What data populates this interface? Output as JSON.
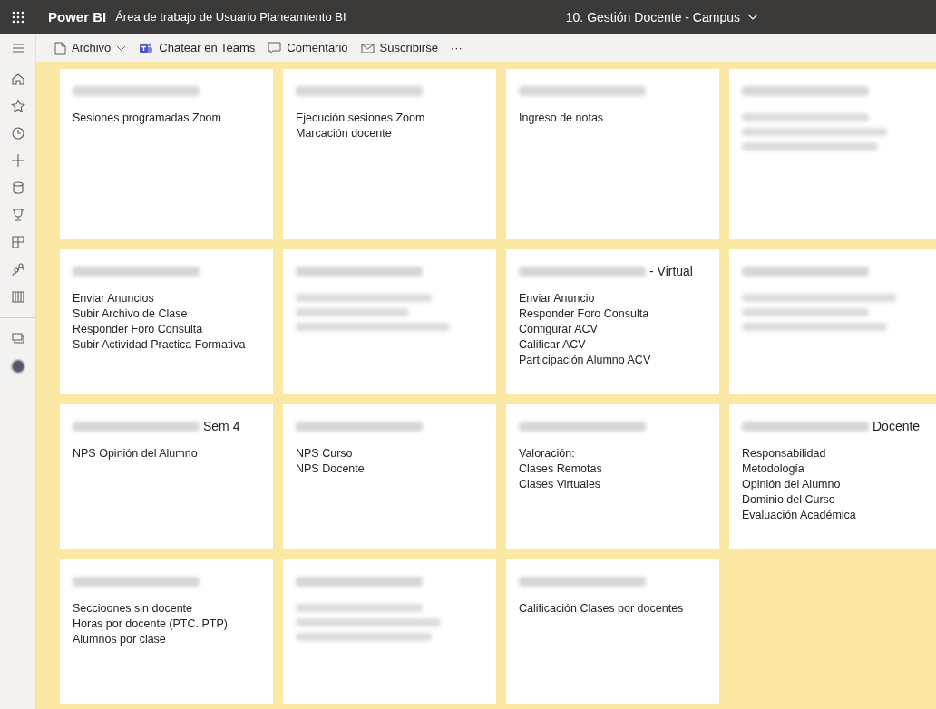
{
  "header": {
    "app_name": "Power BI",
    "workspace": "Área de trabajo de Usuario Planeamiento BI",
    "report": "10. Gestión Docente - Campus"
  },
  "toolbar": [
    {
      "kind": "file",
      "label": "Archivo"
    },
    {
      "kind": "teams",
      "label": "Chatear en Teams"
    },
    {
      "kind": "comment",
      "label": "Comentario"
    },
    {
      "kind": "subscribe",
      "label": "Suscribirse"
    },
    {
      "kind": "more",
      "label": "···"
    }
  ],
  "tiles": [
    {
      "kind": "text",
      "lines": [
        "Sesiones programadas Zoom"
      ]
    },
    {
      "kind": "text",
      "lines": [
        "Ejecución sesiones Zoom",
        "Marcación docente"
      ]
    },
    {
      "kind": "text",
      "lines": [
        "Ingreso de notas"
      ]
    },
    {
      "kind": "blurred"
    },
    {
      "kind": "text",
      "lines": [
        "Enviar Anuncios",
        "Subir Archivo de Clase",
        "Responder Foro Consulta",
        "Subir Actividad Practica Formativa"
      ]
    },
    {
      "kind": "blurred"
    },
    {
      "kind": "text",
      "title_suffix": "- Virtual",
      "lines": [
        "Enviar Anuncio",
        "Responder Foro Consulta",
        "Configurar ACV",
        "Calificar ACV",
        "Participación Alumno ACV"
      ]
    },
    {
      "kind": "blurred"
    },
    {
      "kind": "text",
      "title_suffix": "Sem 4",
      "lines": [
        "NPS Opinión del Alumno"
      ]
    },
    {
      "kind": "text",
      "lines": [
        "NPS Curso",
        "NPS Docente"
      ]
    },
    {
      "kind": "text",
      "lines": [
        "Valoración:",
        "Clases Remotas",
        "Clases Virtuales"
      ]
    },
    {
      "kind": "text",
      "title_suffix": "Docente",
      "lines": [
        "Responsabilidad",
        "Metodología",
        "Opinión del Alumno",
        "Dominio del Curso",
        "Evaluación Académica"
      ]
    },
    {
      "kind": "text",
      "lines": [
        "Seccioones sin docente",
        "Horas por docente (PTC. PTP)",
        "Alumnos por clase"
      ]
    },
    {
      "kind": "blurred"
    },
    {
      "kind": "text",
      "lines": [
        "Calificación Clases por docentes"
      ]
    }
  ]
}
